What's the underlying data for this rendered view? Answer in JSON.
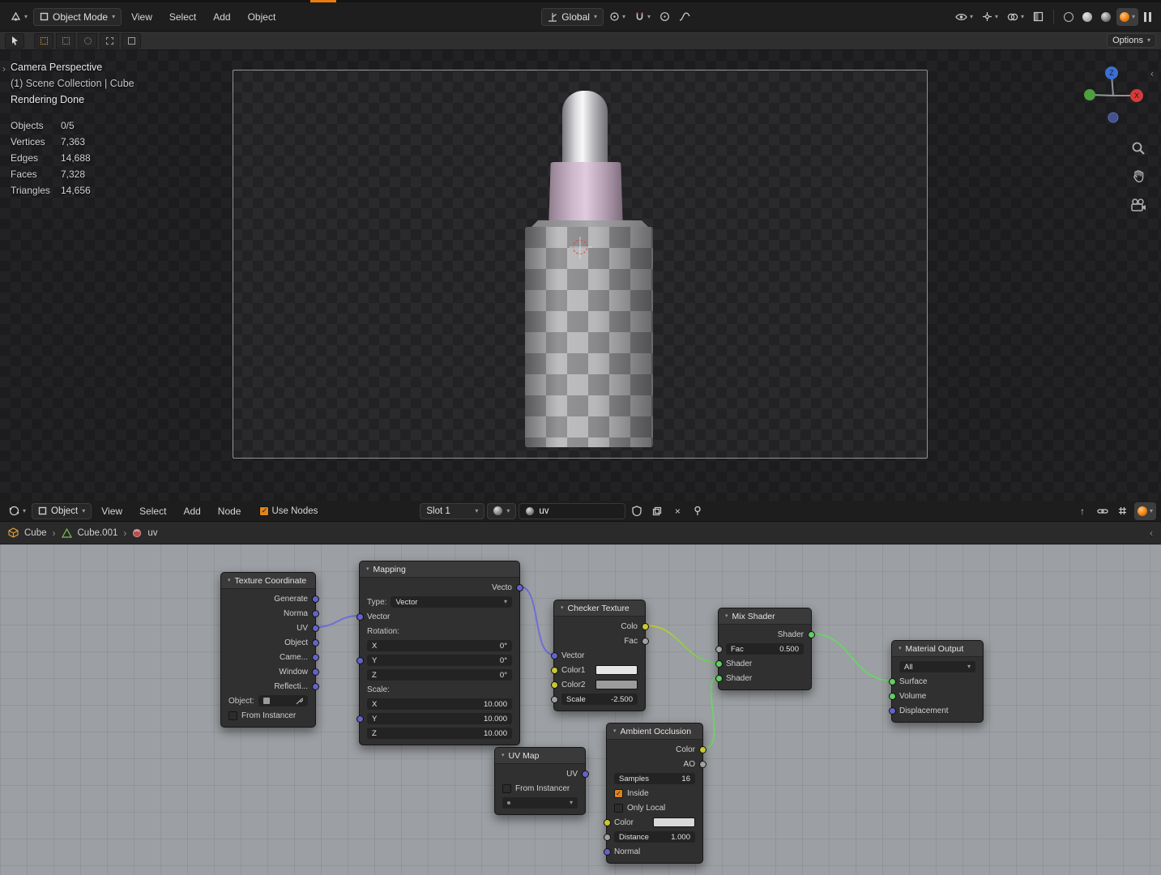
{
  "colors": {
    "accent_orange": "#e87d0d",
    "socket_vector": "#6363c7",
    "socket_color": "#c8c832",
    "socket_shader": "#63cc63",
    "socket_value": "#a1a1a1",
    "link_vector": "#6e6ed8",
    "link_shader": "#6fd06f",
    "checker_color1": "#e6e6e6",
    "checker_color2": "#9c9c9c",
    "ao_color": "#d9d9d9"
  },
  "icons": {
    "chevron_down": "▾",
    "chevron_right": "›",
    "chevron_left": "‹",
    "close": "×",
    "check": "✓",
    "up_arrow": "↑",
    "toolbar_open": "›"
  },
  "viewport": {
    "header": {
      "mode": "Object Mode",
      "menus": [
        "View",
        "Select",
        "Add",
        "Object"
      ],
      "orientation": "Global",
      "options_label": "Options"
    },
    "overlay": {
      "title": "Camera Perspective",
      "subtitle": "(1) Scene Collection | Cube",
      "status": "Rendering Done",
      "stats": [
        {
          "label": "Objects",
          "value": "0/5"
        },
        {
          "label": "Vertices",
          "value": "7,363"
        },
        {
          "label": "Edges",
          "value": "14,688"
        },
        {
          "label": "Faces",
          "value": "7,328"
        },
        {
          "label": "Triangles",
          "value": "14,656"
        }
      ]
    },
    "gizmo": {
      "z_label": "Z",
      "x_label": "X"
    }
  },
  "shader": {
    "header": {
      "object_type": "Object",
      "menus": [
        "View",
        "Select",
        "Add",
        "Node"
      ],
      "use_nodes": "Use Nodes",
      "slot": "Slot 1",
      "material_name": "uv"
    },
    "breadcrumb": [
      "Cube",
      "Cube.001",
      "uv"
    ]
  },
  "nodes": {
    "texture_coordinate": {
      "title": "Texture Coordinate",
      "outputs": [
        "Generate",
        "Norma",
        "UV",
        "Object",
        "Came...",
        "Window",
        "Reflecti..."
      ],
      "object_label": "Object:",
      "from_instancer": "From Instancer"
    },
    "mapping": {
      "title": "Mapping",
      "output": "Vecto",
      "type_label": "Type:",
      "type_value": "Vector",
      "vector_label": "Vector",
      "rotation_label": "Rotation:",
      "rotation_rows": [
        {
          "axis": "X",
          "value": "0°"
        },
        {
          "axis": "Y",
          "value": "0°"
        },
        {
          "axis": "Z",
          "value": "0°"
        }
      ],
      "scale_label": "Scale:",
      "scale_rows": [
        {
          "axis": "X",
          "value": "10.000"
        },
        {
          "axis": "Y",
          "value": "10.000"
        },
        {
          "axis": "Z",
          "value": "10.000"
        }
      ]
    },
    "checker_texture": {
      "title": "Checker Texture",
      "outputs": [
        "Colo",
        "Fac"
      ],
      "inputs": [
        "Vector",
        "Color1",
        "Color2"
      ],
      "scale_label": "Scale",
      "scale_value": "-2.500"
    },
    "mix_shader": {
      "title": "Mix Shader",
      "output": "Shader",
      "fac_label": "Fac",
      "fac_value": "0.500",
      "inputs": [
        "Shader",
        "Shader"
      ]
    },
    "material_output": {
      "title": "Material Output",
      "target": "All",
      "inputs": [
        "Surface",
        "Volume",
        "Displacement"
      ]
    },
    "uv_map": {
      "title": "UV Map",
      "output": "UV",
      "from_instancer": "From Instancer"
    },
    "ambient_occlusion": {
      "title": "Ambient Occlusion",
      "outputs": [
        "Color",
        "AO"
      ],
      "samples_label": "Samples",
      "samples_value": "16",
      "inside_label": "Inside",
      "only_local_label": "Only Local",
      "color_label": "Color",
      "distance_label": "Distance",
      "distance_value": "1.000",
      "normal_label": "Normal"
    }
  }
}
